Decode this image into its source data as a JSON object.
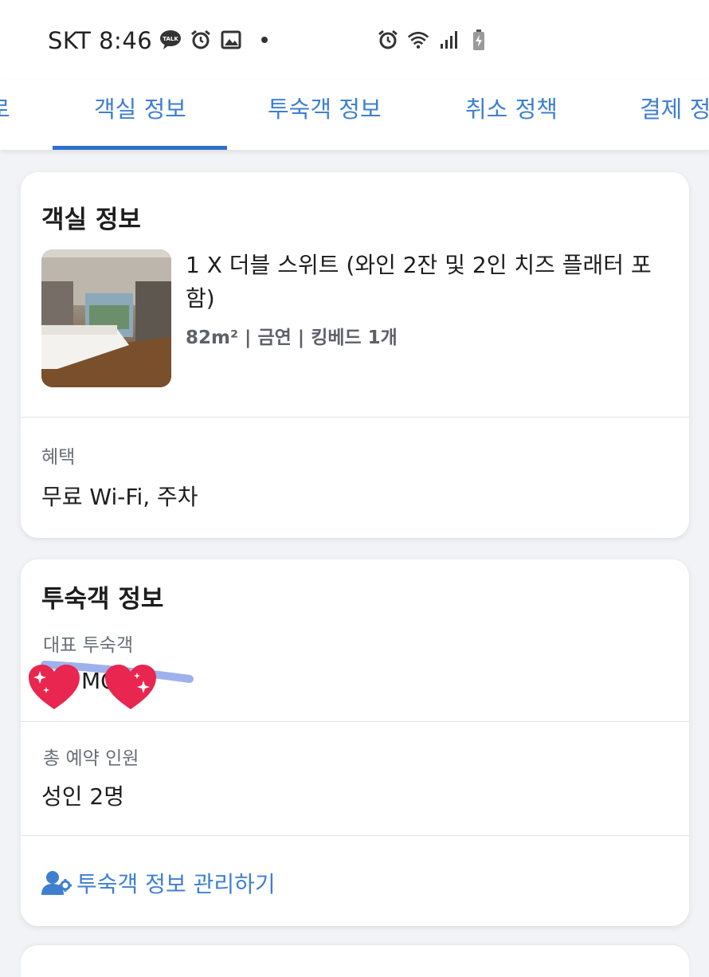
{
  "status_bar": {
    "carrier_time": "SKT 8:46",
    "left_icons": [
      "talk-icon",
      "alarm-icon",
      "image-icon"
    ],
    "right_icons": [
      "alarm-icon",
      "wifi-icon",
      "signal-icon",
      "battery-icon"
    ]
  },
  "tabs": [
    {
      "label": "로"
    },
    {
      "label": "객실 정보",
      "active": true
    },
    {
      "label": "투숙객 정보"
    },
    {
      "label": "취소 정책"
    },
    {
      "label": "결제 정"
    }
  ],
  "room_card": {
    "title": "객실 정보",
    "room_name": "1 X 더블 스위트 (와인 2잔 및 2인 치즈 플래터 포함)",
    "room_meta": "82m² | 금연 | 킹베드 1개",
    "benefits_label": "혜택",
    "benefits_value": "무료 Wi-Fi, 주차"
  },
  "guest_card": {
    "title": "투숙객 정보",
    "main_guest_label": "대표 투숙객",
    "main_guest_value": "MOK",
    "total_label": "총 예약 인원",
    "total_value": "성인 2명",
    "manage_link": "투숙객 정보 관리하기"
  },
  "colors": {
    "accent": "#3f7fd0",
    "tab_indicator": "#2f6fd1",
    "heart": "#e8264f"
  }
}
